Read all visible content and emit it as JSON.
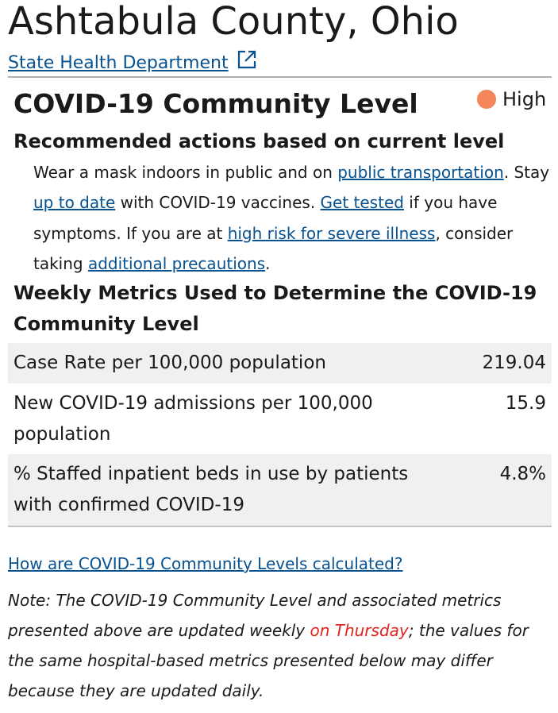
{
  "header": {
    "county_title": "Ashtabula County, Ohio",
    "dept_link": "State Health Department",
    "dept_link_icon": "external-link-icon"
  },
  "community_level": {
    "heading": "COVID-19 Community Level",
    "level": "High",
    "level_color": "#f4865a"
  },
  "actions": {
    "heading": "Recommended actions based on current level",
    "t1": "Wear a mask indoors in public and on ",
    "link_public_transportation": "public transportation",
    "t2": ". Stay ",
    "link_up_to_date": "up to date",
    "t3": " with COVID-19 vaccines. ",
    "link_get_tested": "Get tested",
    "t4": " if you have symptoms. If you are at ",
    "link_high_risk": "high risk for severe illness",
    "t5": ", consider taking ",
    "link_additional_precautions": "additional precautions",
    "t6": "."
  },
  "metrics": {
    "heading": "Weekly Metrics Used to Determine the COVID-19 Community Level",
    "rows": [
      {
        "label": "Case Rate per 100,000 population",
        "value": "219.04"
      },
      {
        "label": "New COVID-19 admissions per 100,000 population",
        "value": "15.9"
      },
      {
        "label": "% Staffed inpatient beds in use by patients with confirmed COVID-19",
        "value": "4.8%"
      }
    ]
  },
  "footer": {
    "how_link": "How are COVID-19 Community Levels calculated?",
    "note_a": "Note: The COVID-19 Community Level and associated metrics presented above are updated weekly ",
    "note_highlight": "on Thursday",
    "note_b": "; the values for the same hospital-based metrics presented below may differ because they are updated daily."
  },
  "colors": {
    "link": "#075290",
    "highlight": "#e0241f",
    "row_shade": "#f0f0f0"
  }
}
